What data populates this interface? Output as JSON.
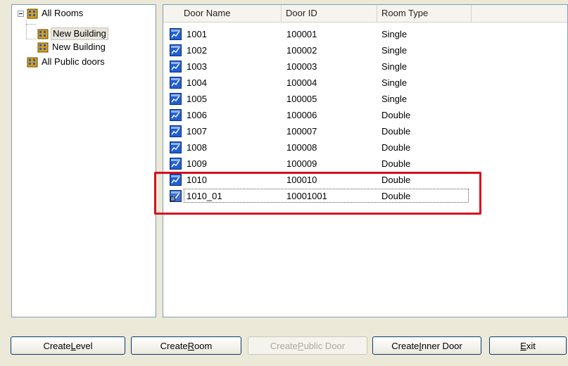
{
  "tree": {
    "root": {
      "label": "All Rooms"
    },
    "children": [
      {
        "label": "New Building",
        "selected": true
      },
      {
        "label": "New Building",
        "selected": false
      }
    ],
    "public": {
      "label": "All Public doors"
    }
  },
  "list": {
    "columns": [
      "Door Name",
      "Door ID",
      "Room Type"
    ],
    "rows": [
      {
        "name": "1001",
        "id": "100001",
        "type": "Single",
        "icon": "door-icon"
      },
      {
        "name": "1002",
        "id": "100002",
        "type": "Single",
        "icon": "door-icon"
      },
      {
        "name": "1003",
        "id": "100003",
        "type": "Single",
        "icon": "door-icon"
      },
      {
        "name": "1004",
        "id": "100004",
        "type": "Single",
        "icon": "door-icon"
      },
      {
        "name": "1005",
        "id": "100005",
        "type": "Single",
        "icon": "door-icon"
      },
      {
        "name": "1006",
        "id": "100006",
        "type": "Double",
        "icon": "door-icon"
      },
      {
        "name": "1007",
        "id": "100007",
        "type": "Double",
        "icon": "door-icon"
      },
      {
        "name": "1008",
        "id": "100008",
        "type": "Double",
        "icon": "door-icon"
      },
      {
        "name": "1009",
        "id": "100009",
        "type": "Double",
        "icon": "door-icon"
      },
      {
        "name": "1010",
        "id": "100010",
        "type": "Double",
        "icon": "door-icon"
      },
      {
        "name": "1010_01",
        "id": "10001001",
        "type": "Double",
        "icon": "inner-door-icon"
      }
    ]
  },
  "buttons": {
    "create_level": {
      "pre": "Create ",
      "key": "L",
      "post": "evel"
    },
    "create_room": {
      "pre": "Create ",
      "key": "R",
      "post": "oom"
    },
    "create_public_door": {
      "pre": "Create ",
      "key": "P",
      "post": "ublic Door"
    },
    "create_inner_door": {
      "pre": "Create ",
      "key": "I",
      "post": "nner Door"
    },
    "exit": {
      "pre": "",
      "key": "E",
      "post": "xit"
    }
  },
  "colors": {
    "highlight": "#d6101e",
    "panel_border": "#7f9db9",
    "window_bg": "#ece9d8"
  }
}
